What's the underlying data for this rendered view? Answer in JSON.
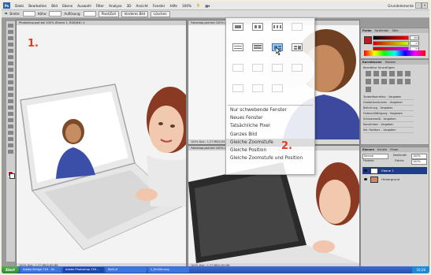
{
  "app": {
    "logo_text": "Ps",
    "menu": [
      "Datei",
      "Bearbeiten",
      "Bild",
      "Ebene",
      "Auswahl",
      "Filter",
      "Analyse",
      "3D",
      "Ansicht",
      "Fenster",
      "Hilfe"
    ],
    "zoom_display": "100%",
    "workspace": "Grundelemente"
  },
  "options_bar": {
    "fields": [
      "Breite:",
      "Höhe:",
      "Auflösung:"
    ],
    "unit": "Pixel/Zoll",
    "buttons": [
      "Vorderes Bild",
      "Löschen"
    ]
  },
  "documents": {
    "doc1_tab": "Photoshop.psd bei 100% (Ebene 1, RGB/8#) ×",
    "doc1_status": "100%   Dok.: 1,27 MB/2,63 MB",
    "doc2_tab": "Fotoshop.psd bei 100% (Ebene 1, RGB/8#)",
    "doc2_status": "100%   Dok.: 1,27 MB/2,63 MB",
    "doc3_tab": "Fotoshop.psd bei 100% (Ebene 1, RGB/8#)",
    "doc3_status": "100%   Dok.: 1,27 MB/2,63 MB"
  },
  "steps": {
    "one": "1.",
    "two": "2."
  },
  "dropdown": {
    "items": [
      "Nur schwebende Fenster",
      "Neues Fenster",
      "Tatsächliche Pixel",
      "Ganzes Bild",
      "Gleiche Zoomstufe",
      "Gleiche Position",
      "Gleiche Zoomstufe und Position"
    ],
    "highlighted_index": 4
  },
  "panels": {
    "color_tabs": [
      "Farbe",
      "Farbfelder",
      "Stile"
    ],
    "color_values": [
      "204",
      "17",
      "27"
    ],
    "adjust_tabs": [
      "Korrekturen",
      "Masken"
    ],
    "adjust_title": "Korrektur hinzufügen",
    "presets": [
      "Tonwertkorrektur - Vorgaben",
      "Gradationskurven - Vorgaben",
      "Belichtung - Vorgaben",
      "Farbton/Sättigung - Vorgaben",
      "Schwarzweiß - Vorgaben",
      "Kanalmixer - Vorgaben",
      "Sel. Farbkorr. - Vorgaben"
    ],
    "layers_tabs": [
      "Ebenen",
      "Kanäle",
      "Pfade"
    ],
    "blend_mode": "Normal",
    "opacity_label": "Deckkraft:",
    "opacity_value": "100%",
    "fill_label": "Fläche:",
    "fill_value": "100%",
    "lock_label": "Fixieren:",
    "layers": [
      "Ebene 1",
      "Hintergrund"
    ]
  },
  "taskbar": {
    "start": "Start",
    "tasks": [
      "Adobe Bridge CS4 - W...",
      "Adobe Photoshop CS4...",
      "MySurf",
      "1_Einführung"
    ],
    "active_task": 1,
    "clock": "16:26"
  },
  "colors": {
    "accent_red": "#e53b1c",
    "selection_blue": "#1f3c88",
    "foreground": "#c4161c"
  }
}
